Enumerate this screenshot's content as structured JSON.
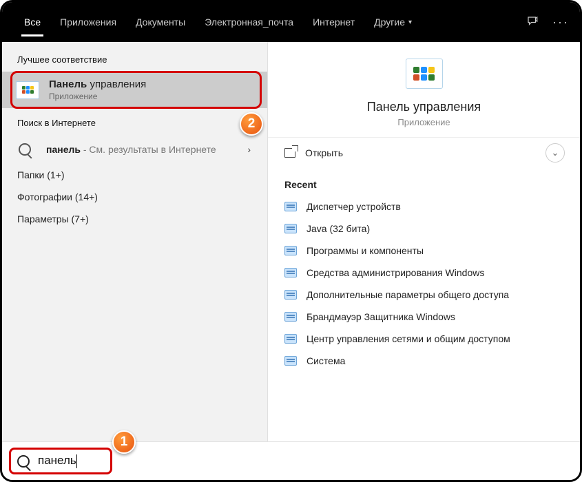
{
  "tabs": {
    "all": "Все",
    "apps": "Приложения",
    "docs": "Документы",
    "email": "Электронная_почта",
    "internet": "Интернет",
    "more": "Другие"
  },
  "sections": {
    "best_match": "Лучшее соответствие",
    "web_search": "Поиск в Интернете"
  },
  "best_match": {
    "title_bold": "Панель",
    "title_rest": " управления",
    "subtitle": "Приложение"
  },
  "internet_search": {
    "prefix": "панель",
    "tail": " - См. результаты в Интернете"
  },
  "categories": {
    "folders": "Папки (1+)",
    "photos": "Фотографии (14+)",
    "settings": "Параметры (7+)"
  },
  "preview": {
    "title": "Панель управления",
    "subtitle": "Приложение",
    "open": "Открыть",
    "recent_header": "Recent"
  },
  "recent": [
    "Диспетчер устройств",
    "Java (32 бита)",
    "Программы и компоненты",
    "Средства администрирования Windows",
    "Дополнительные параметры общего доступа",
    "Брандмауэр Защитника Windows",
    "Центр управления сетями и общим доступом",
    "Система"
  ],
  "search": {
    "query": "панель"
  },
  "annotations": {
    "badge1": "1",
    "badge2": "2"
  }
}
